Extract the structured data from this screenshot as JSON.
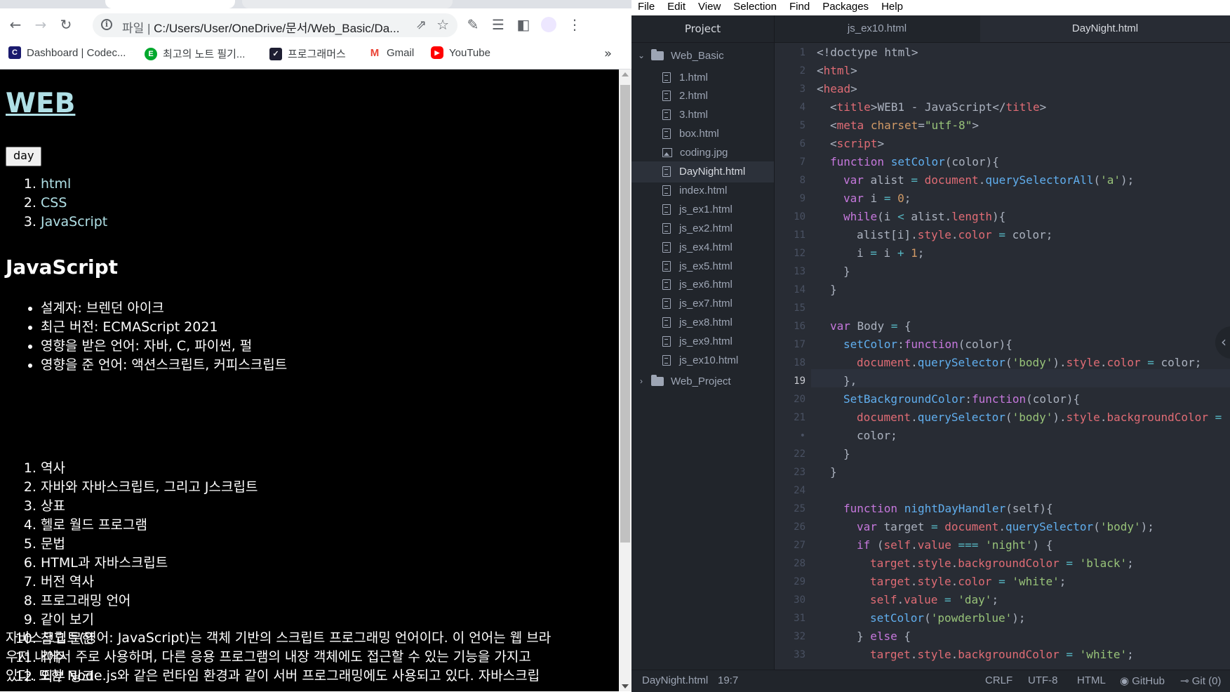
{
  "browser": {
    "toolbar": {
      "url_scheme": "파일",
      "url_path": "C:/Users/User/OneDrive/문서/Web_Basic/Da..."
    },
    "bookmarks": [
      {
        "label": "Dashboard | Codec...",
        "icon": "codecademy-icon",
        "color": "#3a10e5"
      },
      {
        "label": "최고의 노트 필기...",
        "icon": "evernote-icon",
        "color": "#00a82d"
      },
      {
        "label": "프로그래머스",
        "icon": "programmers-icon",
        "color": "#1e1e32"
      },
      {
        "label": "Gmail",
        "icon": "gmail-icon",
        "color": "#ea4335"
      },
      {
        "label": "YouTube",
        "icon": "youtube-icon",
        "color": "#ff0000"
      }
    ],
    "page": {
      "title_link": "WEB",
      "toggle_button": "day",
      "toc": [
        "html",
        "CSS",
        "JavaScript"
      ],
      "heading": "JavaScript",
      "facts": [
        "설계자: 브렌던 아이크",
        "최근 버전: ECMAScript 2021",
        "영향을 받은 언어: 자바, C, 파이썬, 펄",
        "영향을 준 언어: 액션스크립트, 커피스크립트"
      ],
      "contents": [
        "역사",
        "자바와 자바스크립트, 그리고 J스크립트",
        "상표",
        "헬로 월드 프로그램",
        "문법",
        "HTML과 자바스크립트",
        "버전 역사",
        "프로그래밍 언어",
        "같이 보기",
        "참고 문헌",
        "각주",
        "외부 링크"
      ],
      "intro_lines": [
        "자바스크립트(영어: JavaScript)는 객체 기반의 스크립트 프로그래밍 언어이다. 이 언어는 웹 브라",
        "우저 내에서 주로 사용하며, 다른 응용 프로그램의 내장 객체에도 접근할 수 있는 기능을 가지고",
        "있다. 또한 Node.js와 같은 런타임 환경과 같이 서버 프로그래밍에도 사용되고 있다. 자바스크립"
      ],
      "background": "#000000",
      "link_color": "powderblue"
    }
  },
  "atom": {
    "menu": [
      "File",
      "Edit",
      "View",
      "Selection",
      "Find",
      "Packages",
      "Help"
    ],
    "tree": {
      "title": "Project",
      "root": "Web_Basic",
      "files": [
        {
          "name": "1.html",
          "type": "file"
        },
        {
          "name": "2.html",
          "type": "file"
        },
        {
          "name": "3.html",
          "type": "file"
        },
        {
          "name": "box.html",
          "type": "file"
        },
        {
          "name": "coding.jpg",
          "type": "image"
        },
        {
          "name": "DayNight.html",
          "type": "file",
          "selected": true
        },
        {
          "name": "index.html",
          "type": "file"
        },
        {
          "name": "js_ex1.html",
          "type": "file"
        },
        {
          "name": "js_ex2.html",
          "type": "file"
        },
        {
          "name": "js_ex4.html",
          "type": "file"
        },
        {
          "name": "js_ex5.html",
          "type": "file"
        },
        {
          "name": "js_ex6.html",
          "type": "file"
        },
        {
          "name": "js_ex7.html",
          "type": "file"
        },
        {
          "name": "js_ex8.html",
          "type": "file"
        },
        {
          "name": "js_ex9.html",
          "type": "file"
        },
        {
          "name": "js_ex10.html",
          "type": "file"
        }
      ],
      "collapsed_folder": "Web_Project"
    },
    "tabs": [
      "js_ex10.html",
      "DayNight.html"
    ],
    "line_numbers": [
      "1",
      "2",
      "3",
      "4",
      "5",
      "6",
      "7",
      "8",
      "9",
      "10",
      "11",
      "12",
      "13",
      "14",
      "15",
      "16",
      "17",
      "18",
      "19",
      "20",
      "21",
      "•",
      "22",
      "23",
      "24",
      "25",
      "26",
      "27",
      "28",
      "29",
      "30",
      "31",
      "32",
      "33"
    ],
    "current_line": "19",
    "status": {
      "file": "DayNight.html",
      "cursor": "19:7",
      "line_ending": "CRLF",
      "encoding": "UTF-8",
      "grammar": "HTML",
      "github": "GitHub",
      "git": "Git (0)"
    }
  }
}
